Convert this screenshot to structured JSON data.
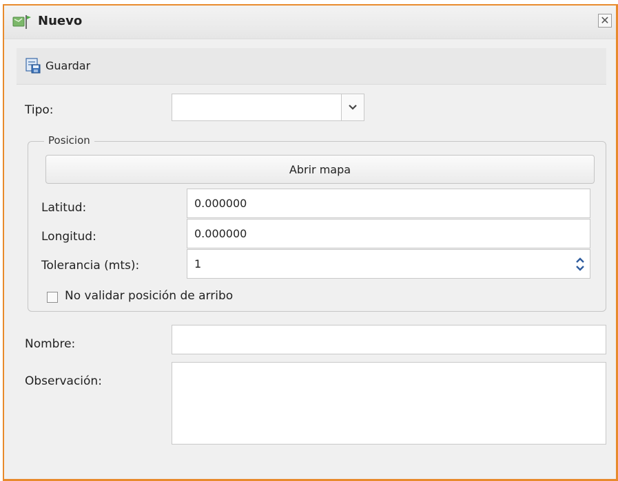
{
  "window": {
    "title": "Nuevo",
    "close_symbol": "✕",
    "accent_color": "#e88a2c"
  },
  "toolbar": {
    "save_label": "Guardar",
    "save_icon": "save-form-icon"
  },
  "form": {
    "tipo_label": "Tipo:",
    "tipo_value": "",
    "posicion": {
      "legend": "Posicion",
      "open_map_label": "Abrir mapa",
      "latitud_label": "Latitud:",
      "latitud_value": "0.000000",
      "longitud_label": "Longitud:",
      "longitud_value": "0.000000",
      "tolerancia_label": "Tolerancia (mts):",
      "tolerancia_value": "1",
      "no_validar_label": "No validar posición de arribo",
      "no_validar_checked": false
    },
    "nombre_label": "Nombre:",
    "nombre_value": "",
    "observacion_label": "Observación:",
    "observacion_value": ""
  }
}
